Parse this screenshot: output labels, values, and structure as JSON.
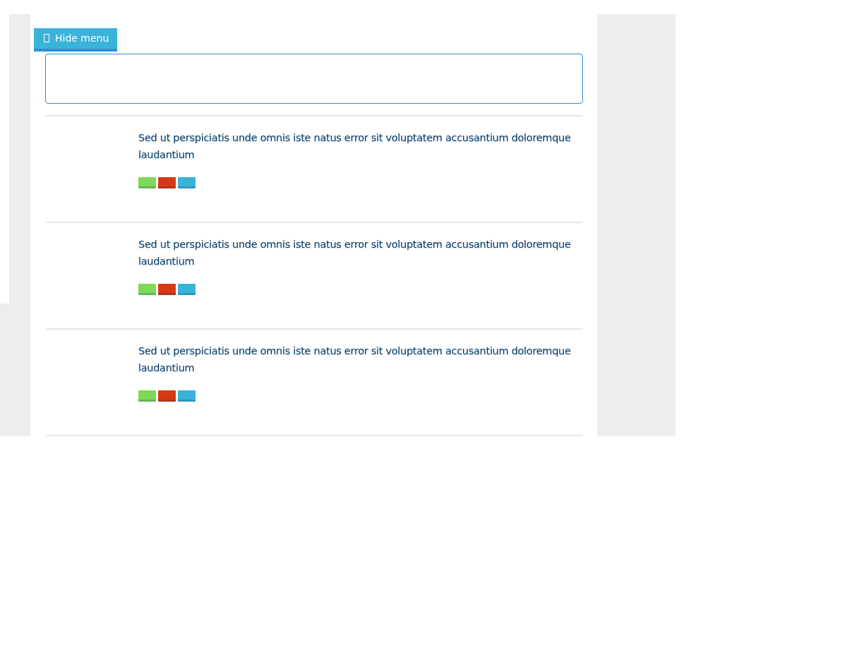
{
  "menu_button": {
    "label": "Hide menu"
  },
  "items": [
    {
      "text": "Sed ut perspiciatis unde omnis iste natus error sit voluptatem accusantium doloremque laudantium",
      "tags": [
        {
          "color": "#7ed957"
        },
        {
          "color": "#d63a14"
        },
        {
          "color": "#3ab3d9"
        }
      ]
    },
    {
      "text": "Sed ut perspiciatis unde omnis iste natus error sit voluptatem accusantium doloremque laudantium",
      "tags": [
        {
          "color": "#7ed957"
        },
        {
          "color": "#d63a14"
        },
        {
          "color": "#3ab3d9"
        }
      ]
    },
    {
      "text": "Sed ut perspiciatis unde omnis iste natus error sit voluptatem accusantium doloremque laudantium",
      "tags": [
        {
          "color": "#7ed957"
        },
        {
          "color": "#d63a14"
        },
        {
          "color": "#3ab3d9"
        }
      ]
    }
  ]
}
